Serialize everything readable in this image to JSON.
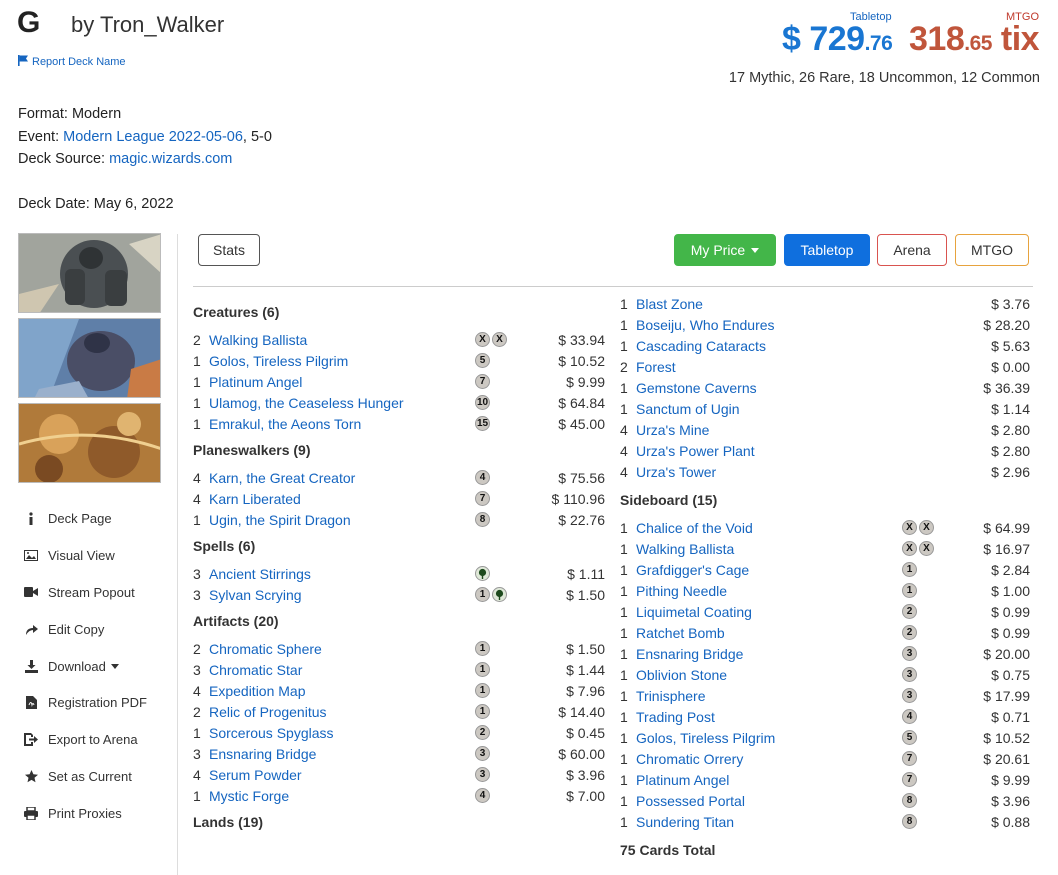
{
  "header": {
    "letter": "G",
    "author": "by Tron_Walker",
    "report_label": "Report Deck Name"
  },
  "prices": {
    "tabletop_label": "Tabletop",
    "mtgo_label": "MTGO",
    "tabletop_main": "$ 729",
    "tabletop_cents": ".76",
    "mtgo_main": "318",
    "mtgo_cents": ".65",
    "mtgo_unit": " tix",
    "rarity": "17 Mythic, 26 Rare, 18 Uncommon, 12 Common"
  },
  "info": {
    "format": "Format: Modern",
    "event_prefix": "Event: ",
    "event_link": "Modern League 2022-05-06",
    "event_suffix": ", 5-0",
    "source_prefix": "Deck Source: ",
    "source_link": "magic.wizards.com",
    "date": "Deck Date: May 6, 2022"
  },
  "sidebar": {
    "items": [
      {
        "label": "Deck Page",
        "icon": "info-icon"
      },
      {
        "label": "Visual View",
        "icon": "image-icon"
      },
      {
        "label": "Stream Popout",
        "icon": "video-icon"
      },
      {
        "label": "Edit Copy",
        "icon": "share-arrow-icon"
      },
      {
        "label": "Download",
        "icon": "download-icon"
      },
      {
        "label": "Registration PDF",
        "icon": "pdf-icon"
      },
      {
        "label": "Export to Arena",
        "icon": "export-icon"
      },
      {
        "label": "Set as Current",
        "icon": "star-icon"
      },
      {
        "label": "Print Proxies",
        "icon": "print-icon"
      }
    ]
  },
  "toolbar": {
    "stats": "Stats",
    "my_price": "My Price",
    "tabletop": "Tabletop",
    "arena": "Arena",
    "mtgo": "MTGO"
  },
  "left_sections": [
    {
      "title": "Creatures (6)",
      "cards": [
        {
          "qty": "2",
          "name": "Walking Ballista",
          "mana": [
            "X",
            "X"
          ],
          "price": "$ 33.94"
        },
        {
          "qty": "1",
          "name": "Golos, Tireless Pilgrim",
          "mana": [
            "5"
          ],
          "price": "$ 10.52"
        },
        {
          "qty": "1",
          "name": "Platinum Angel",
          "mana": [
            "7"
          ],
          "price": "$ 9.99"
        },
        {
          "qty": "1",
          "name": "Ulamog, the Ceaseless Hunger",
          "mana": [
            "10"
          ],
          "price": "$ 64.84"
        },
        {
          "qty": "1",
          "name": "Emrakul, the Aeons Torn",
          "mana": [
            "15"
          ],
          "price": "$ 45.00"
        }
      ]
    },
    {
      "title": "Planeswalkers (9)",
      "cards": [
        {
          "qty": "4",
          "name": "Karn, the Great Creator",
          "mana": [
            "4"
          ],
          "price": "$ 75.56"
        },
        {
          "qty": "4",
          "name": "Karn Liberated",
          "mana": [
            "7"
          ],
          "price": "$ 110.96"
        },
        {
          "qty": "1",
          "name": "Ugin, the Spirit Dragon",
          "mana": [
            "8"
          ],
          "price": "$ 22.76"
        }
      ]
    },
    {
      "title": "Spells (6)",
      "cards": [
        {
          "qty": "3",
          "name": "Ancient Stirrings",
          "mana": [
            "G"
          ],
          "price": "$ 1.11"
        },
        {
          "qty": "3",
          "name": "Sylvan Scrying",
          "mana": [
            "1",
            "G"
          ],
          "price": "$ 1.50"
        }
      ]
    },
    {
      "title": "Artifacts (20)",
      "cards": [
        {
          "qty": "2",
          "name": "Chromatic Sphere",
          "mana": [
            "1"
          ],
          "price": "$ 1.50"
        },
        {
          "qty": "3",
          "name": "Chromatic Star",
          "mana": [
            "1"
          ],
          "price": "$ 1.44"
        },
        {
          "qty": "4",
          "name": "Expedition Map",
          "mana": [
            "1"
          ],
          "price": "$ 7.96"
        },
        {
          "qty": "2",
          "name": "Relic of Progenitus",
          "mana": [
            "1"
          ],
          "price": "$ 14.40"
        },
        {
          "qty": "1",
          "name": "Sorcerous Spyglass",
          "mana": [
            "2"
          ],
          "price": "$ 0.45"
        },
        {
          "qty": "3",
          "name": "Ensnaring Bridge",
          "mana": [
            "3"
          ],
          "price": "$ 60.00"
        },
        {
          "qty": "4",
          "name": "Serum Powder",
          "mana": [
            "3"
          ],
          "price": "$ 3.96"
        },
        {
          "qty": "1",
          "name": "Mystic Forge",
          "mana": [
            "4"
          ],
          "price": "$ 7.00"
        }
      ]
    },
    {
      "title": "Lands (19)",
      "cards": []
    }
  ],
  "right_lands": [
    {
      "qty": "1",
      "name": "Blast Zone",
      "mana": [],
      "price": "$ 3.76"
    },
    {
      "qty": "1",
      "name": "Boseiju, Who Endures",
      "mana": [],
      "price": "$ 28.20"
    },
    {
      "qty": "1",
      "name": "Cascading Cataracts",
      "mana": [],
      "price": "$ 5.63"
    },
    {
      "qty": "2",
      "name": "Forest",
      "mana": [],
      "price": "$ 0.00"
    },
    {
      "qty": "1",
      "name": "Gemstone Caverns",
      "mana": [],
      "price": "$ 36.39"
    },
    {
      "qty": "1",
      "name": "Sanctum of Ugin",
      "mana": [],
      "price": "$ 1.14"
    },
    {
      "qty": "4",
      "name": "Urza's Mine",
      "mana": [],
      "price": "$ 2.80"
    },
    {
      "qty": "4",
      "name": "Urza's Power Plant",
      "mana": [],
      "price": "$ 2.80"
    },
    {
      "qty": "4",
      "name": "Urza's Tower",
      "mana": [],
      "price": "$ 2.96"
    }
  ],
  "sideboard": {
    "title": "Sideboard (15)",
    "cards": [
      {
        "qty": "1",
        "name": "Chalice of the Void",
        "mana": [
          "X",
          "X"
        ],
        "price": "$ 64.99"
      },
      {
        "qty": "1",
        "name": "Walking Ballista",
        "mana": [
          "X",
          "X"
        ],
        "price": "$ 16.97"
      },
      {
        "qty": "1",
        "name": "Grafdigger's Cage",
        "mana": [
          "1"
        ],
        "price": "$ 2.84"
      },
      {
        "qty": "1",
        "name": "Pithing Needle",
        "mana": [
          "1"
        ],
        "price": "$ 1.00"
      },
      {
        "qty": "1",
        "name": "Liquimetal Coating",
        "mana": [
          "2"
        ],
        "price": "$ 0.99"
      },
      {
        "qty": "1",
        "name": "Ratchet Bomb",
        "mana": [
          "2"
        ],
        "price": "$ 0.99"
      },
      {
        "qty": "1",
        "name": "Ensnaring Bridge",
        "mana": [
          "3"
        ],
        "price": "$ 20.00"
      },
      {
        "qty": "1",
        "name": "Oblivion Stone",
        "mana": [
          "3"
        ],
        "price": "$ 0.75"
      },
      {
        "qty": "1",
        "name": "Trinisphere",
        "mana": [
          "3"
        ],
        "price": "$ 17.99"
      },
      {
        "qty": "1",
        "name": "Trading Post",
        "mana": [
          "4"
        ],
        "price": "$ 0.71"
      },
      {
        "qty": "1",
        "name": "Golos, Tireless Pilgrim",
        "mana": [
          "5"
        ],
        "price": "$ 10.52"
      },
      {
        "qty": "1",
        "name": "Chromatic Orrery",
        "mana": [
          "7"
        ],
        "price": "$ 20.61"
      },
      {
        "qty": "1",
        "name": "Platinum Angel",
        "mana": [
          "7"
        ],
        "price": "$ 9.99"
      },
      {
        "qty": "1",
        "name": "Possessed Portal",
        "mana": [
          "8"
        ],
        "price": "$ 3.96"
      },
      {
        "qty": "1",
        "name": "Sundering Titan",
        "mana": [
          "8"
        ],
        "price": "$ 0.88"
      }
    ]
  },
  "total": "75 Cards Total",
  "colors": {
    "link": "#1565c0",
    "tabletop": "#1976d2",
    "mtgo": "#c0553b",
    "my_price_btn": "#43b649",
    "tabletop_btn": "#0f6fde"
  }
}
